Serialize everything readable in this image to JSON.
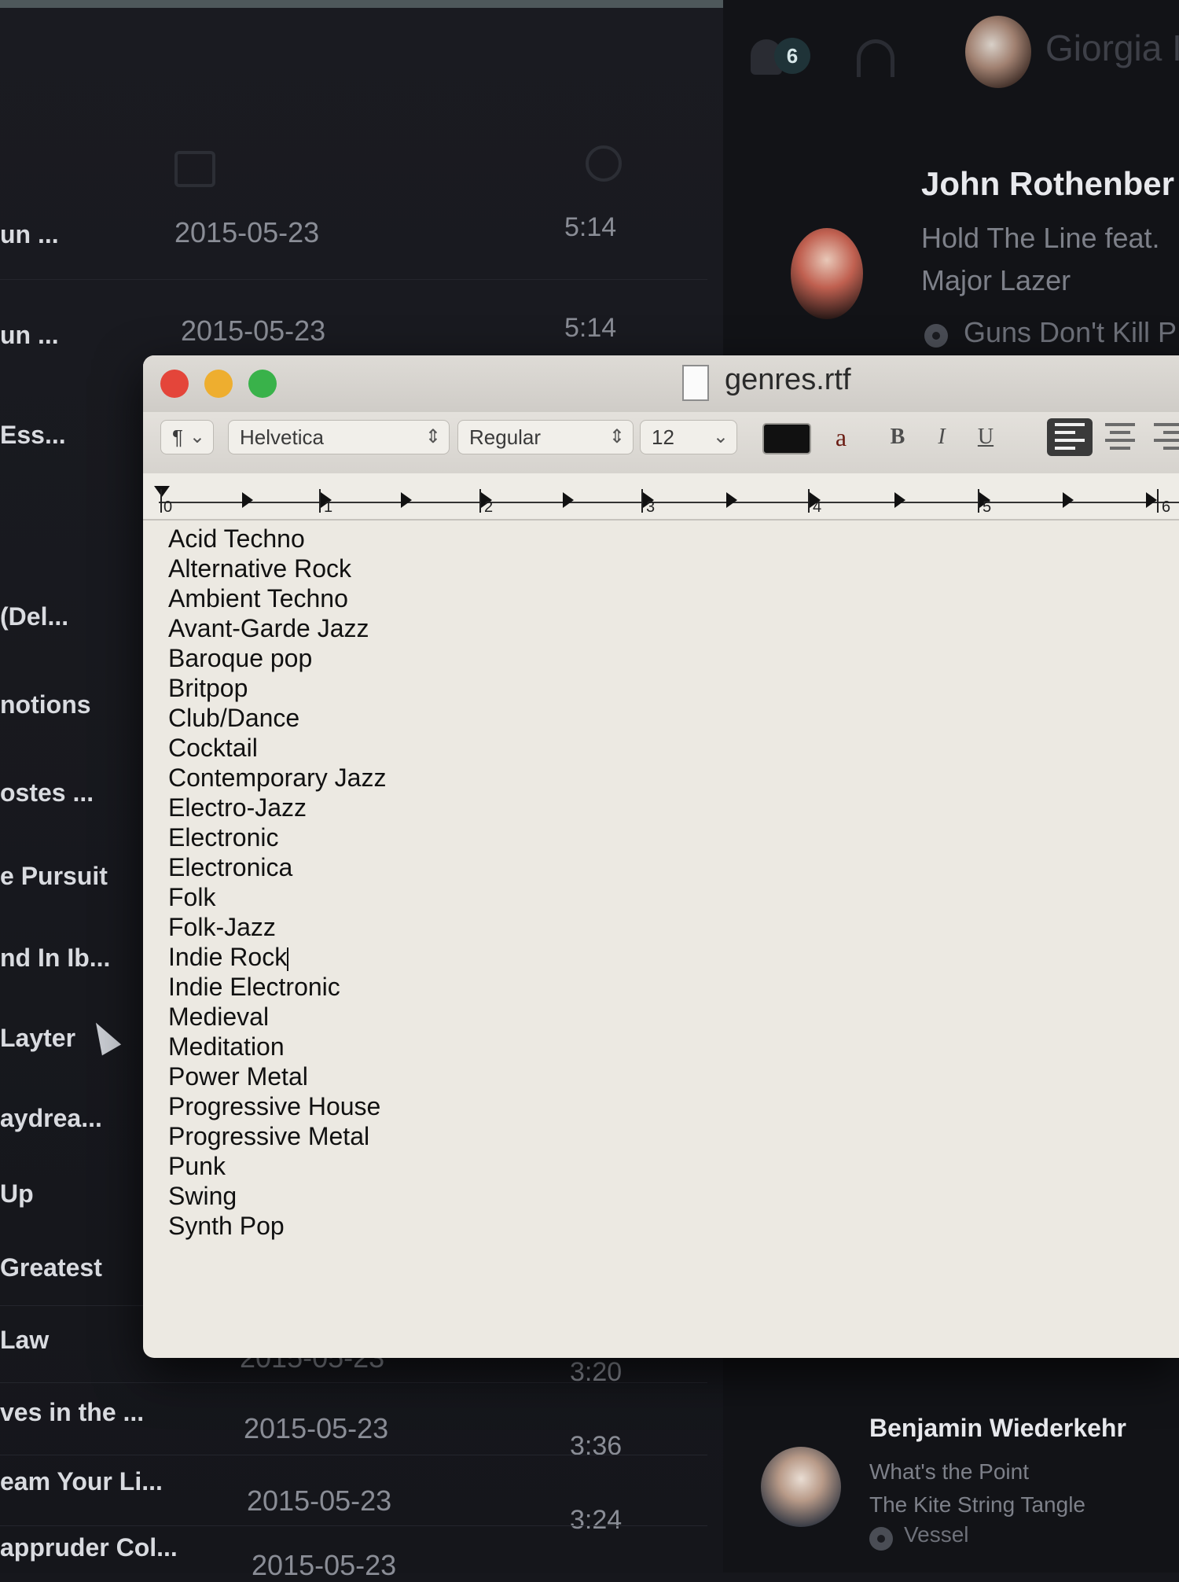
{
  "header": {
    "notification_count": "6",
    "user_name": "Giorgia I"
  },
  "tracks": [
    {
      "title": "un ...",
      "date": "2015-05-23",
      "duration": "5:14"
    },
    {
      "title": "un ...",
      "date": "2015-05-23",
      "duration": "5:14"
    },
    {
      "title": "Ess..."
    },
    {
      "title": "(Del..."
    },
    {
      "title": "notions"
    },
    {
      "title": "ostes ..."
    },
    {
      "title": "e Pursuit"
    },
    {
      "title": "nd In Ib..."
    },
    {
      "title": "Layter"
    },
    {
      "title": "aydrea..."
    },
    {
      "title": "Up"
    },
    {
      "title": "Greatest"
    },
    {
      "title": "Law",
      "date": "2015-05-23",
      "duration": "3:20"
    },
    {
      "title": "ves in the ...",
      "date": "2015-05-23",
      "duration": "3:36"
    },
    {
      "title": "eam Your Li...",
      "date": "2015-05-23",
      "duration": "3:24"
    },
    {
      "title": "appruder Col...",
      "date": "2015-05-23"
    }
  ],
  "activity": [
    {
      "artist": "John Rothenber",
      "track": "Hold The Line feat.",
      "track2": "Major Lazer",
      "album": "Guns Don't Kill P"
    },
    {
      "artist": "Benjamin Wiederkehr",
      "track": "What's the Point",
      "track2": "The Kite String Tangle",
      "album": "Vessel"
    }
  ],
  "textedit": {
    "title": "genres.rtf",
    "paragraph_menu": "¶",
    "font_family": "Helvetica",
    "font_style": "Regular",
    "font_size": "12",
    "bold_label": "B",
    "italic_label": "I",
    "underline_label": "U",
    "strike_label": "a",
    "ruler_numbers": [
      "0",
      "1",
      "2",
      "3",
      "4",
      "5",
      "6"
    ],
    "genres": [
      "Acid Techno",
      "Alternative Rock",
      "Ambient Techno",
      "Avant-Garde Jazz",
      "Baroque pop",
      "Britpop",
      "Club/Dance",
      "Cocktail",
      "Contemporary Jazz",
      "Electro-Jazz",
      "Electronic",
      "Electronica",
      "Folk",
      "Folk-Jazz",
      "Indie Rock",
      "Indie Electronic",
      "Medieval",
      "Meditation",
      "Power Metal",
      "Progressive House",
      "Progressive Metal",
      "Punk",
      "Swing",
      "Synth Pop"
    ],
    "caret_after_line": 14,
    "text_color": "#111111"
  }
}
